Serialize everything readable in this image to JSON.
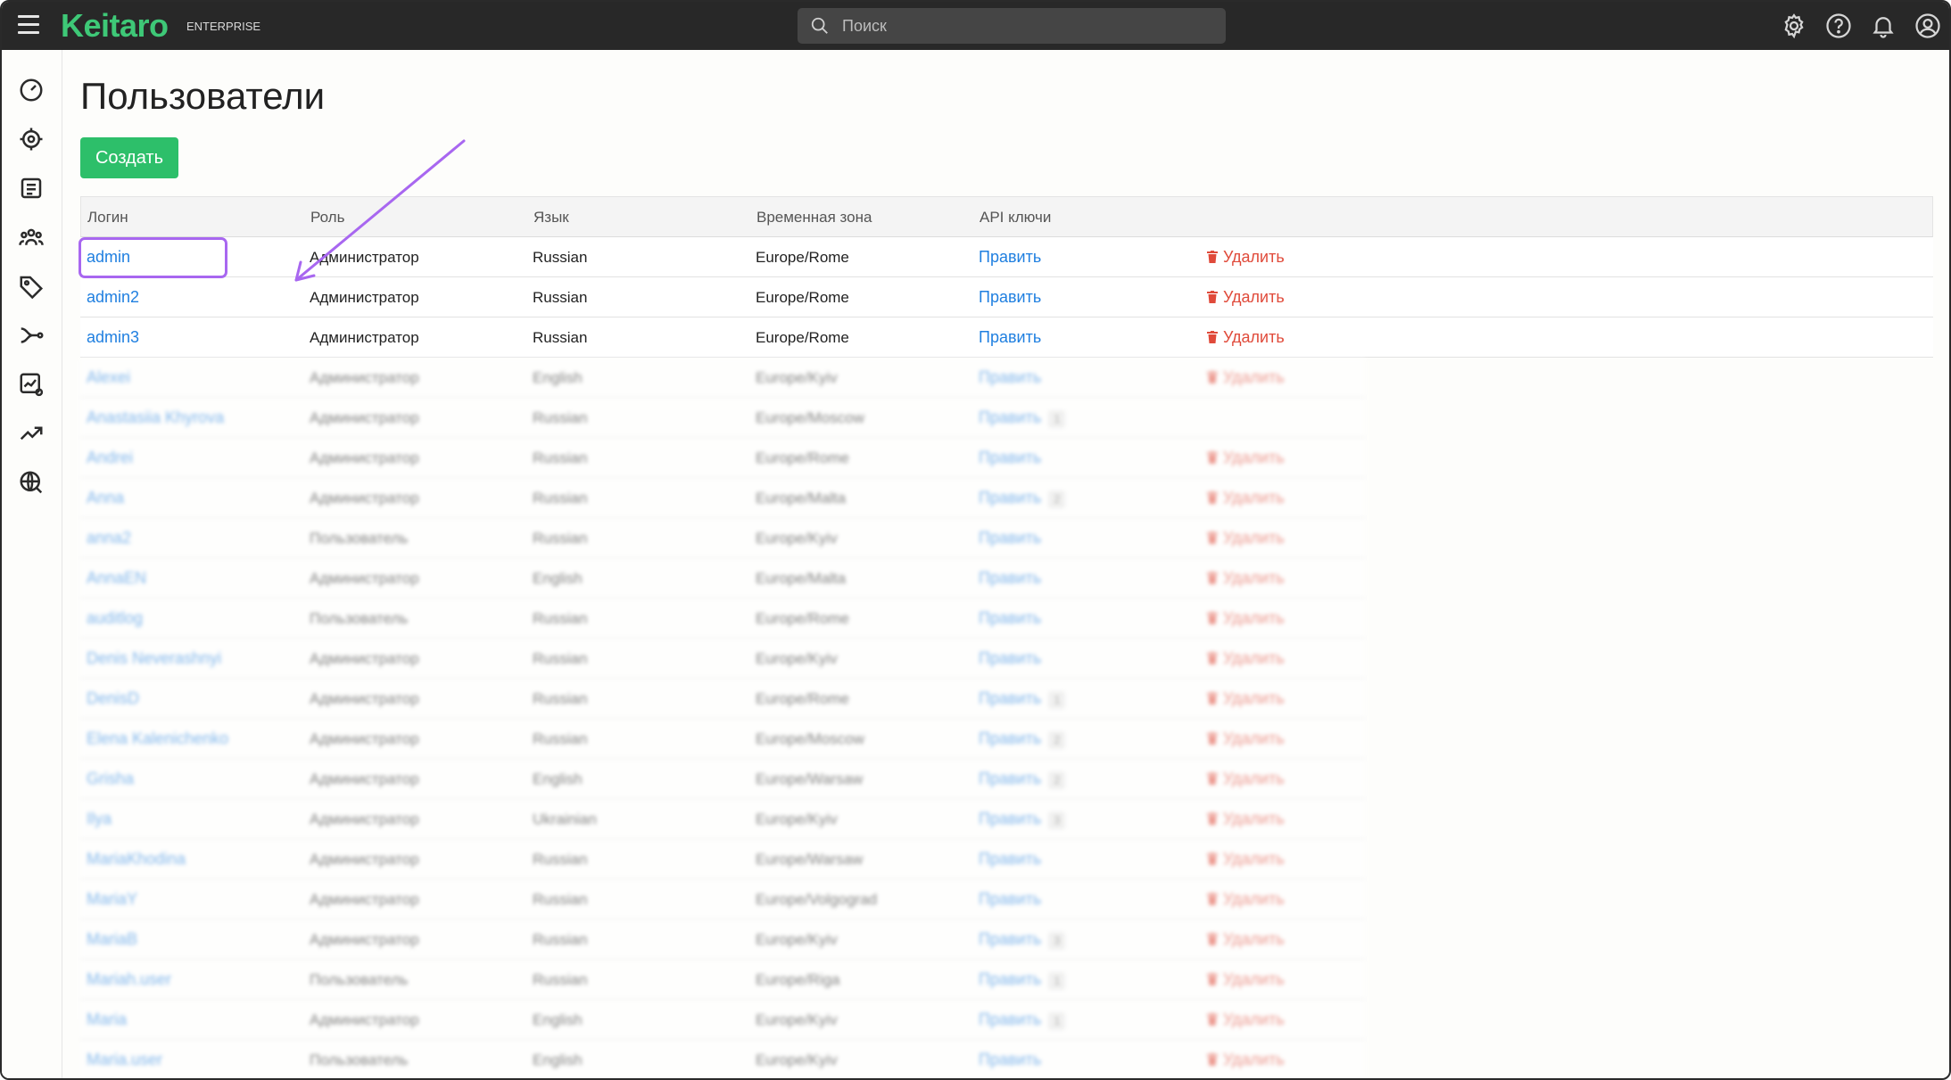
{
  "app": {
    "logo": "Keitaro",
    "edition": "ENTERPRISE",
    "search_placeholder": "Поиск",
    "accent": "#3ec877"
  },
  "topbar_icons": [
    "menu-icon",
    "gear-icon",
    "help-icon",
    "bell-icon",
    "account-icon"
  ],
  "sidebar": {
    "icons": [
      "dashboard-icon",
      "target-icon",
      "reports-icon",
      "users-group-icon",
      "tag-icon",
      "flows-icon",
      "chart-settings-icon",
      "trending-icon",
      "globe-icon"
    ]
  },
  "page": {
    "title": "Пользователи",
    "create_label": "Создать"
  },
  "table": {
    "headers": [
      "Логин",
      "Роль",
      "Язык",
      "Временная зона",
      "API ключи",
      ""
    ],
    "edit_label": "Правка",
    "delete_label": "Удалить",
    "rows": [
      {
        "login": "admin",
        "role": "Администратор",
        "lang": "Russian",
        "tz": "Europe/Rome",
        "api": "Править",
        "badge": "",
        "delete": "Удалить"
      },
      {
        "login": "admin2",
        "role": "Администратор",
        "lang": "Russian",
        "tz": "Europe/Rome",
        "api": "Править",
        "badge": "",
        "delete": "Удалить"
      },
      {
        "login": "admin3",
        "role": "Администратор",
        "lang": "Russian",
        "tz": "Europe/Rome",
        "api": "Править",
        "badge": "",
        "delete": "Удалить"
      }
    ],
    "blurred_rows": [
      {
        "login": "Alexei",
        "role": "Администратор",
        "lang": "English",
        "tz": "Europe/Kyiv",
        "api": "Править",
        "badge": "",
        "delete": "Удалить"
      },
      {
        "login": "Anastasiia Khyrova",
        "role": "Администратор",
        "lang": "Russian",
        "tz": "Europe/Moscow",
        "api": "Править",
        "badge": "1",
        "delete": ""
      },
      {
        "login": "Andrei",
        "role": "Администратор",
        "lang": "Russian",
        "tz": "Europe/Rome",
        "api": "Править",
        "badge": "",
        "delete": "Удалить"
      },
      {
        "login": "Anna",
        "role": "Администратор",
        "lang": "Russian",
        "tz": "Europe/Malta",
        "api": "Править",
        "badge": "2",
        "delete": "Удалить"
      },
      {
        "login": "anna2",
        "role": "Пользователь",
        "lang": "Russian",
        "tz": "Europe/Kyiv",
        "api": "Править",
        "badge": "",
        "delete": "Удалить"
      },
      {
        "login": "AnnaEN",
        "role": "Администратор",
        "lang": "English",
        "tz": "Europe/Malta",
        "api": "Править",
        "badge": "",
        "delete": "Удалить"
      },
      {
        "login": "auditlog",
        "role": "Пользователь",
        "lang": "Russian",
        "tz": "Europe/Rome",
        "api": "Править",
        "badge": "",
        "delete": "Удалить"
      },
      {
        "login": "Denis Neverashnyi",
        "role": "Администратор",
        "lang": "Russian",
        "tz": "Europe/Kyiv",
        "api": "Править",
        "badge": "",
        "delete": "Удалить"
      },
      {
        "login": "DenisD",
        "role": "Администратор",
        "lang": "Russian",
        "tz": "Europe/Rome",
        "api": "Править",
        "badge": "1",
        "delete": "Удалить"
      },
      {
        "login": "Elena Kalenichenko",
        "role": "Администратор",
        "lang": "Russian",
        "tz": "Europe/Moscow",
        "api": "Править",
        "badge": "2",
        "delete": "Удалить"
      },
      {
        "login": "Grisha",
        "role": "Администратор",
        "lang": "English",
        "tz": "Europe/Warsaw",
        "api": "Править",
        "badge": "2",
        "delete": "Удалить"
      },
      {
        "login": "Ilya",
        "role": "Администратор",
        "lang": "Ukrainian",
        "tz": "Europe/Kyiv",
        "api": "Править",
        "badge": "3",
        "delete": "Удалить"
      },
      {
        "login": "MariaKhodina",
        "role": "Администратор",
        "lang": "Russian",
        "tz": "Europe/Warsaw",
        "api": "Править",
        "badge": "",
        "delete": "Удалить"
      },
      {
        "login": "MariaY",
        "role": "Администратор",
        "lang": "Russian",
        "tz": "Europe/Volgograd",
        "api": "Править",
        "badge": "",
        "delete": "Удалить"
      },
      {
        "login": "MariaB",
        "role": "Администратор",
        "lang": "Russian",
        "tz": "Europe/Kyiv",
        "api": "Править",
        "badge": "3",
        "delete": "Удалить"
      },
      {
        "login": "Mariah.user",
        "role": "Пользователь",
        "lang": "Russian",
        "tz": "Europe/Riga",
        "api": "Править",
        "badge": "1",
        "delete": "Удалить"
      },
      {
        "login": "Maria",
        "role": "Администратор",
        "lang": "English",
        "tz": "Europe/Kyiv",
        "api": "Править",
        "badge": "1",
        "delete": "Удалить"
      },
      {
        "login": "Maria.user",
        "role": "Пользователь",
        "lang": "English",
        "tz": "Europe/Kyiv",
        "api": "Править",
        "badge": "",
        "delete": "Удалить"
      }
    ]
  },
  "annotation": {
    "color": "#a867f0"
  }
}
